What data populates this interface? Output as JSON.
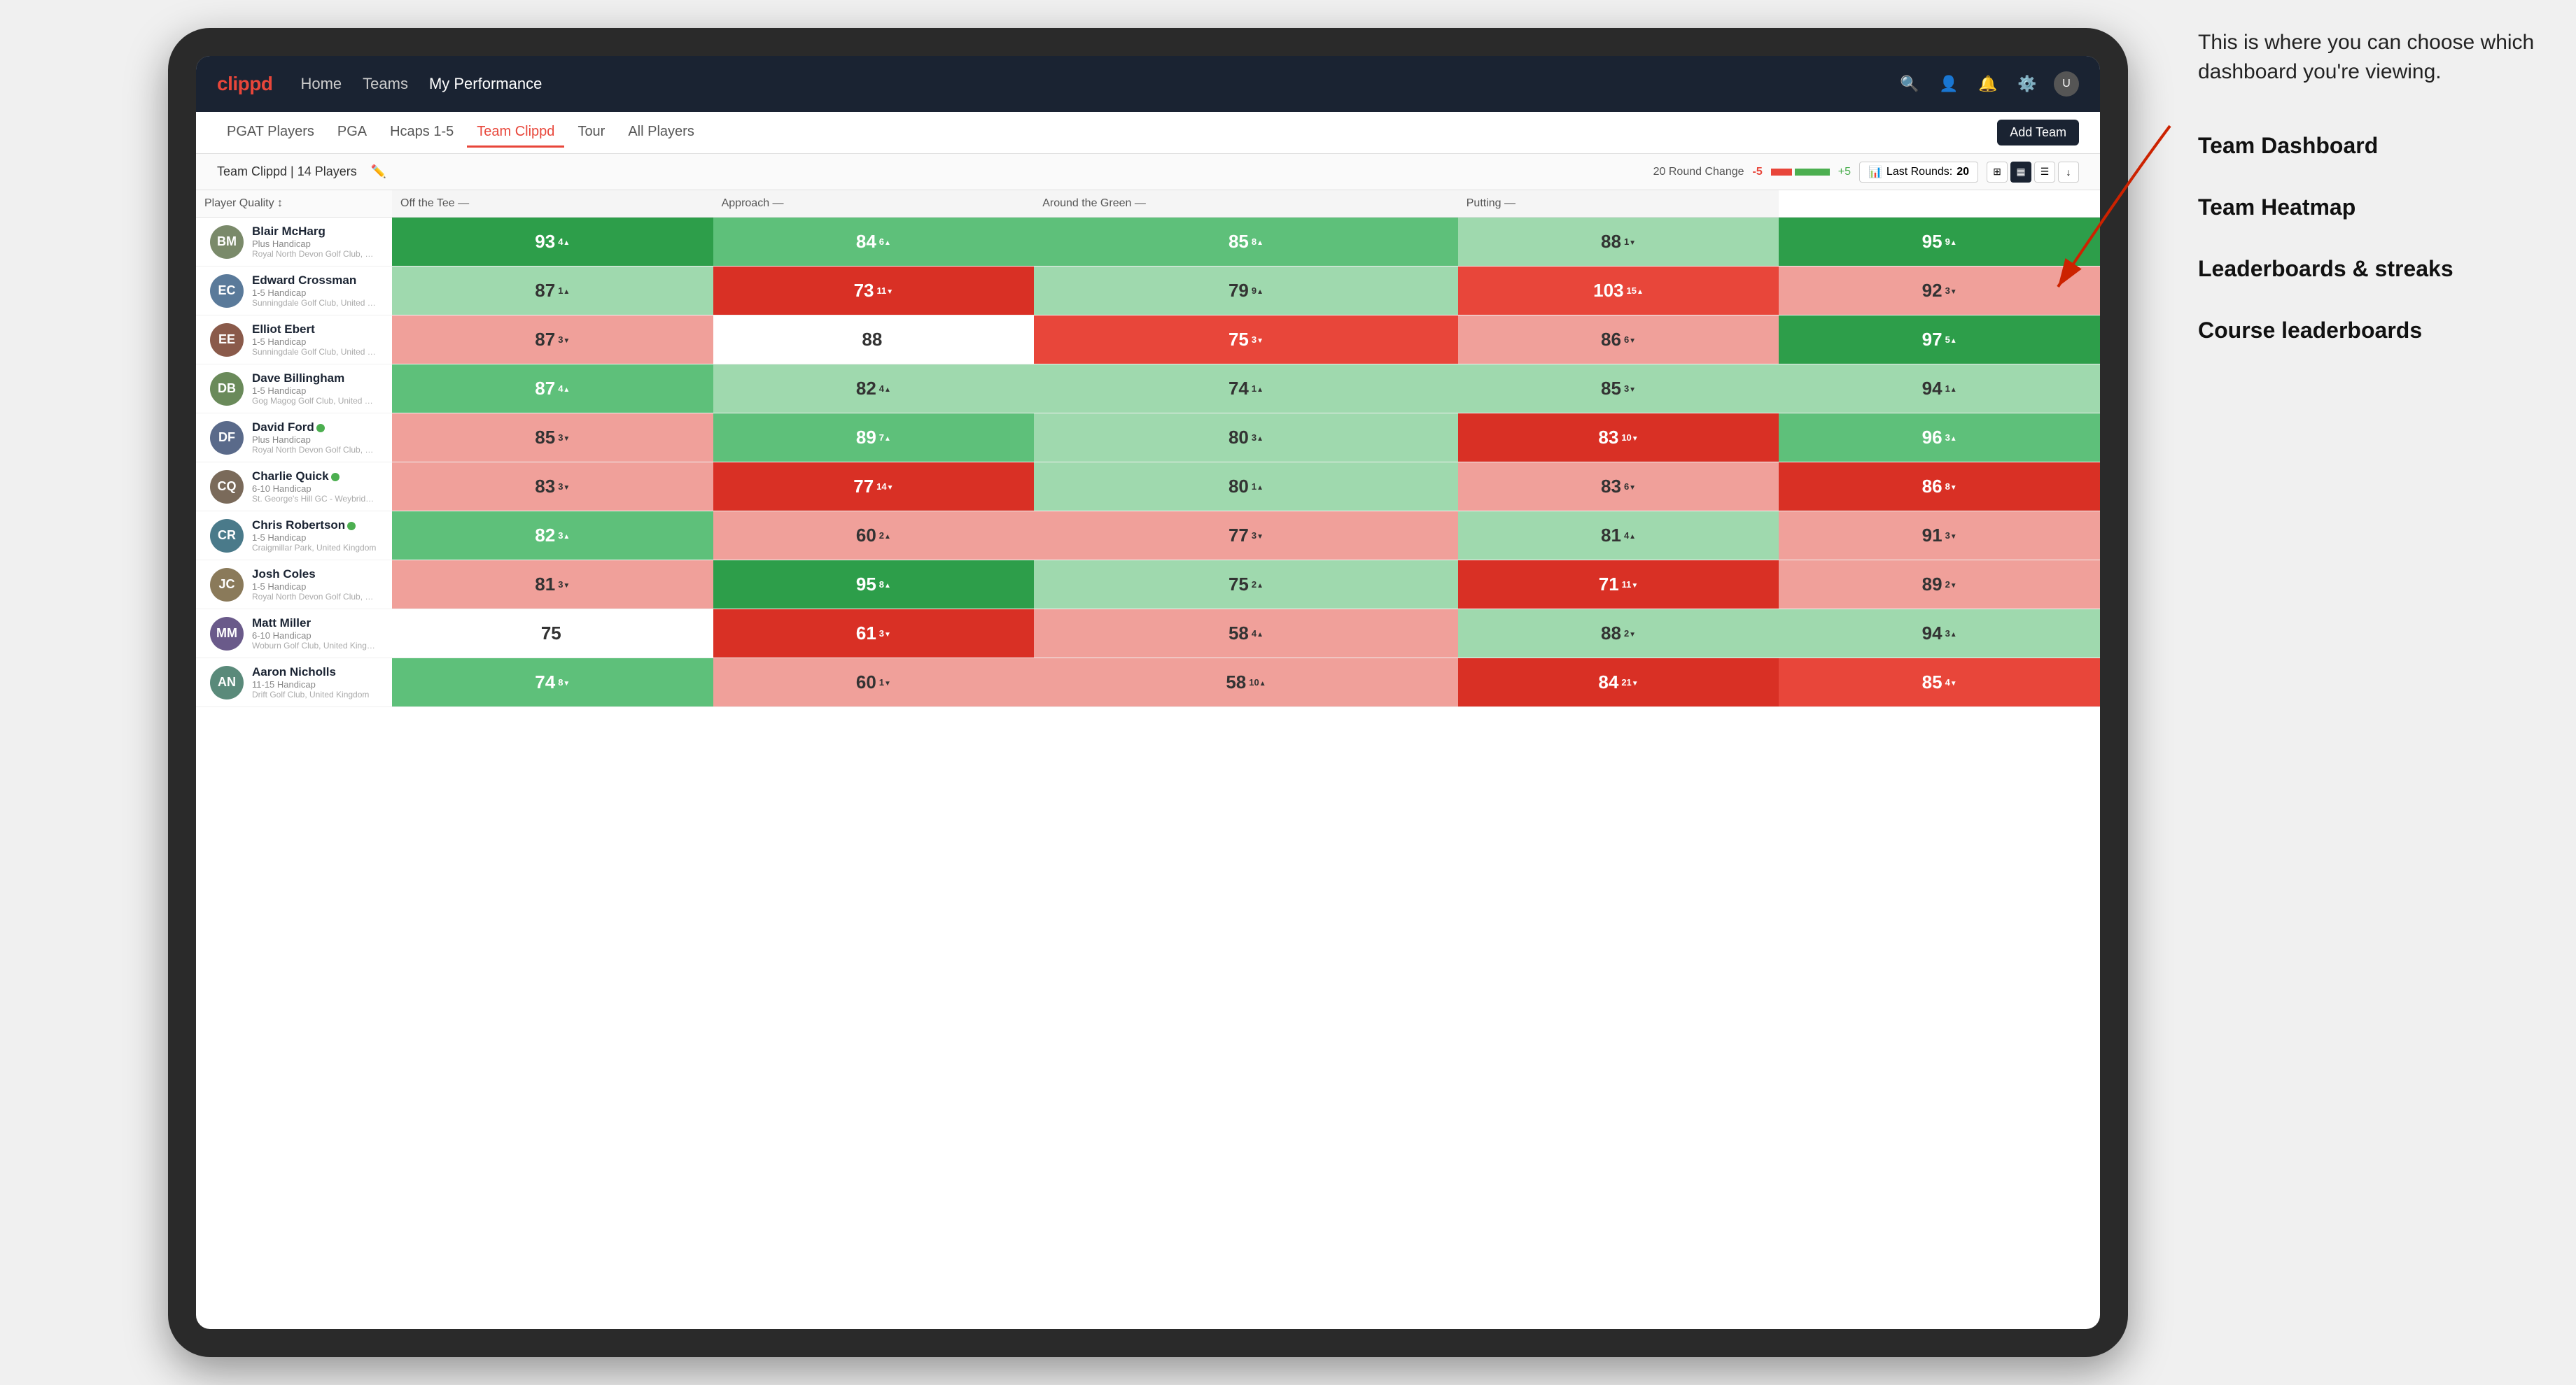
{
  "annotation": {
    "intro_text": "This is where you can choose which dashboard you're viewing.",
    "items": [
      "Team Dashboard",
      "Team Heatmap",
      "Leaderboards & streaks",
      "Course leaderboards"
    ]
  },
  "navbar": {
    "logo": "clippd",
    "links": [
      {
        "label": "Home",
        "active": false
      },
      {
        "label": "Teams",
        "active": false
      },
      {
        "label": "My Performance",
        "active": true
      }
    ],
    "icons": [
      "search",
      "person",
      "bell",
      "settings",
      "avatar"
    ]
  },
  "subnav": {
    "links": [
      {
        "label": "PGAT Players",
        "active": false
      },
      {
        "label": "PGA",
        "active": false
      },
      {
        "label": "Hcaps 1-5",
        "active": false
      },
      {
        "label": "Team Clippd",
        "active": true
      },
      {
        "label": "Tour",
        "active": false
      },
      {
        "label": "All Players",
        "active": false
      }
    ],
    "add_team_label": "Add Team"
  },
  "teambar": {
    "team_name": "Team Clippd",
    "player_count": "14 Players",
    "round_change_label": "20 Round Change",
    "change_value": "-5",
    "plus_value": "+5",
    "last_rounds_label": "Last Rounds:",
    "last_rounds_value": "20"
  },
  "table": {
    "headers": {
      "player": "Player Quality",
      "off_tee": "Off the Tee",
      "approach": "Approach",
      "around_green": "Around the Green",
      "putting": "Putting"
    },
    "rows": [
      {
        "name": "Blair McHarg",
        "handicap": "Plus Handicap",
        "club": "Royal North Devon Golf Club, United Kingdom",
        "initials": "BM",
        "avatar_color": "#7a8a6a",
        "player_quality": {
          "value": 93,
          "change": 4,
          "dir": "up",
          "bg": "bg-green-dark"
        },
        "off_tee": {
          "value": 84,
          "change": 6,
          "dir": "up",
          "bg": "bg-green-mid"
        },
        "approach": {
          "value": 85,
          "change": 8,
          "dir": "up",
          "bg": "bg-green-mid"
        },
        "around_green": {
          "value": 88,
          "change": -1,
          "dir": "down",
          "bg": "bg-green-light"
        },
        "putting": {
          "value": 95,
          "change": 9,
          "dir": "up",
          "bg": "bg-green-dark"
        }
      },
      {
        "name": "Edward Crossman",
        "handicap": "1-5 Handicap",
        "club": "Sunningdale Golf Club, United Kingdom",
        "initials": "EC",
        "avatar_color": "#5a7a9a",
        "player_quality": {
          "value": 87,
          "change": 1,
          "dir": "up",
          "bg": "bg-green-light"
        },
        "off_tee": {
          "value": 73,
          "change": -11,
          "dir": "down",
          "bg": "bg-red-dark"
        },
        "approach": {
          "value": 79,
          "change": 9,
          "dir": "up",
          "bg": "bg-green-light"
        },
        "around_green": {
          "value": 103,
          "change": 15,
          "dir": "up",
          "bg": "bg-red-mid"
        },
        "putting": {
          "value": 92,
          "change": -3,
          "dir": "down",
          "bg": "bg-red-light"
        }
      },
      {
        "name": "Elliot Ebert",
        "handicap": "1-5 Handicap",
        "club": "Sunningdale Golf Club, United Kingdom",
        "initials": "EE",
        "avatar_color": "#8a5a4a",
        "player_quality": {
          "value": 87,
          "change": -3,
          "dir": "down",
          "bg": "bg-red-light"
        },
        "off_tee": {
          "value": 88,
          "change": null,
          "dir": null,
          "bg": "bg-white"
        },
        "approach": {
          "value": 75,
          "change": -3,
          "dir": "down",
          "bg": "bg-red-mid"
        },
        "around_green": {
          "value": 86,
          "change": -6,
          "dir": "down",
          "bg": "bg-red-light"
        },
        "putting": {
          "value": 97,
          "change": 5,
          "dir": "up",
          "bg": "bg-green-dark"
        }
      },
      {
        "name": "Dave Billingham",
        "handicap": "1-5 Handicap",
        "club": "Gog Magog Golf Club, United Kingdom",
        "initials": "DB",
        "avatar_color": "#6a8a5a",
        "player_quality": {
          "value": 87,
          "change": 4,
          "dir": "up",
          "bg": "bg-green-mid"
        },
        "off_tee": {
          "value": 82,
          "change": 4,
          "dir": "up",
          "bg": "bg-green-light"
        },
        "approach": {
          "value": 74,
          "change": 1,
          "dir": "up",
          "bg": "bg-green-light"
        },
        "around_green": {
          "value": 85,
          "change": -3,
          "dir": "down",
          "bg": "bg-green-light"
        },
        "putting": {
          "value": 94,
          "change": 1,
          "dir": "up",
          "bg": "bg-green-light"
        }
      },
      {
        "name": "David Ford",
        "handicap": "Plus Handicap",
        "club": "Royal North Devon Golf Club, United Kingdom",
        "initials": "DF",
        "avatar_color": "#5a6a8a",
        "verified": true,
        "player_quality": {
          "value": 85,
          "change": -3,
          "dir": "down",
          "bg": "bg-red-light"
        },
        "off_tee": {
          "value": 89,
          "change": 7,
          "dir": "up",
          "bg": "bg-green-mid"
        },
        "approach": {
          "value": 80,
          "change": 3,
          "dir": "up",
          "bg": "bg-green-light"
        },
        "around_green": {
          "value": 83,
          "change": -10,
          "dir": "down",
          "bg": "bg-red-dark"
        },
        "putting": {
          "value": 96,
          "change": 3,
          "dir": "up",
          "bg": "bg-green-mid"
        }
      },
      {
        "name": "Charlie Quick",
        "handicap": "6-10 Handicap",
        "club": "St. George's Hill GC - Weybridge - Surrey, Uni...",
        "initials": "CQ",
        "avatar_color": "#7a6a5a",
        "verified": true,
        "player_quality": {
          "value": 83,
          "change": -3,
          "dir": "down",
          "bg": "bg-red-light"
        },
        "off_tee": {
          "value": 77,
          "change": -14,
          "dir": "down",
          "bg": "bg-red-dark"
        },
        "approach": {
          "value": 80,
          "change": 1,
          "dir": "up",
          "bg": "bg-green-light"
        },
        "around_green": {
          "value": 83,
          "change": -6,
          "dir": "down",
          "bg": "bg-red-light"
        },
        "putting": {
          "value": 86,
          "change": -8,
          "dir": "down",
          "bg": "bg-red-dark"
        }
      },
      {
        "name": "Chris Robertson",
        "handicap": "1-5 Handicap",
        "club": "Craigmillar Park, United Kingdom",
        "initials": "CR",
        "avatar_color": "#4a7a8a",
        "verified": true,
        "player_quality": {
          "value": 82,
          "change": 3,
          "dir": "up",
          "bg": "bg-green-mid"
        },
        "off_tee": {
          "value": 60,
          "change": 2,
          "dir": "up",
          "bg": "bg-red-light"
        },
        "approach": {
          "value": 77,
          "change": -3,
          "dir": "down",
          "bg": "bg-red-light"
        },
        "around_green": {
          "value": 81,
          "change": 4,
          "dir": "up",
          "bg": "bg-green-light"
        },
        "putting": {
          "value": 91,
          "change": -3,
          "dir": "down",
          "bg": "bg-red-light"
        }
      },
      {
        "name": "Josh Coles",
        "handicap": "1-5 Handicap",
        "club": "Royal North Devon Golf Club, United Kingdom",
        "initials": "JC",
        "avatar_color": "#8a7a5a",
        "player_quality": {
          "value": 81,
          "change": -3,
          "dir": "down",
          "bg": "bg-red-light"
        },
        "off_tee": {
          "value": 95,
          "change": 8,
          "dir": "up",
          "bg": "bg-green-dark"
        },
        "approach": {
          "value": 75,
          "change": 2,
          "dir": "up",
          "bg": "bg-green-light"
        },
        "around_green": {
          "value": 71,
          "change": -11,
          "dir": "down",
          "bg": "bg-red-dark"
        },
        "putting": {
          "value": 89,
          "change": -2,
          "dir": "down",
          "bg": "bg-red-light"
        }
      },
      {
        "name": "Matt Miller",
        "handicap": "6-10 Handicap",
        "club": "Woburn Golf Club, United Kingdom",
        "initials": "MM",
        "avatar_color": "#6a5a8a",
        "player_quality": {
          "value": 75,
          "change": null,
          "dir": null,
          "bg": "bg-white"
        },
        "off_tee": {
          "value": 61,
          "change": -3,
          "dir": "down",
          "bg": "bg-red-dark"
        },
        "approach": {
          "value": 58,
          "change": 4,
          "dir": "up",
          "bg": "bg-red-light"
        },
        "around_green": {
          "value": 88,
          "change": -2,
          "dir": "down",
          "bg": "bg-green-light"
        },
        "putting": {
          "value": 94,
          "change": 3,
          "dir": "up",
          "bg": "bg-green-light"
        }
      },
      {
        "name": "Aaron Nicholls",
        "handicap": "11-15 Handicap",
        "club": "Drift Golf Club, United Kingdom",
        "initials": "AN",
        "avatar_color": "#5a8a7a",
        "player_quality": {
          "value": 74,
          "change": -8,
          "dir": "down",
          "bg": "bg-green-mid"
        },
        "off_tee": {
          "value": 60,
          "change": -1,
          "dir": "down",
          "bg": "bg-red-light"
        },
        "approach": {
          "value": 58,
          "change": 10,
          "dir": "up",
          "bg": "bg-red-light"
        },
        "around_green": {
          "value": 84,
          "change": -21,
          "dir": "down",
          "bg": "bg-red-dark"
        },
        "putting": {
          "value": 85,
          "change": -4,
          "dir": "down",
          "bg": "bg-red-mid"
        }
      }
    ]
  }
}
